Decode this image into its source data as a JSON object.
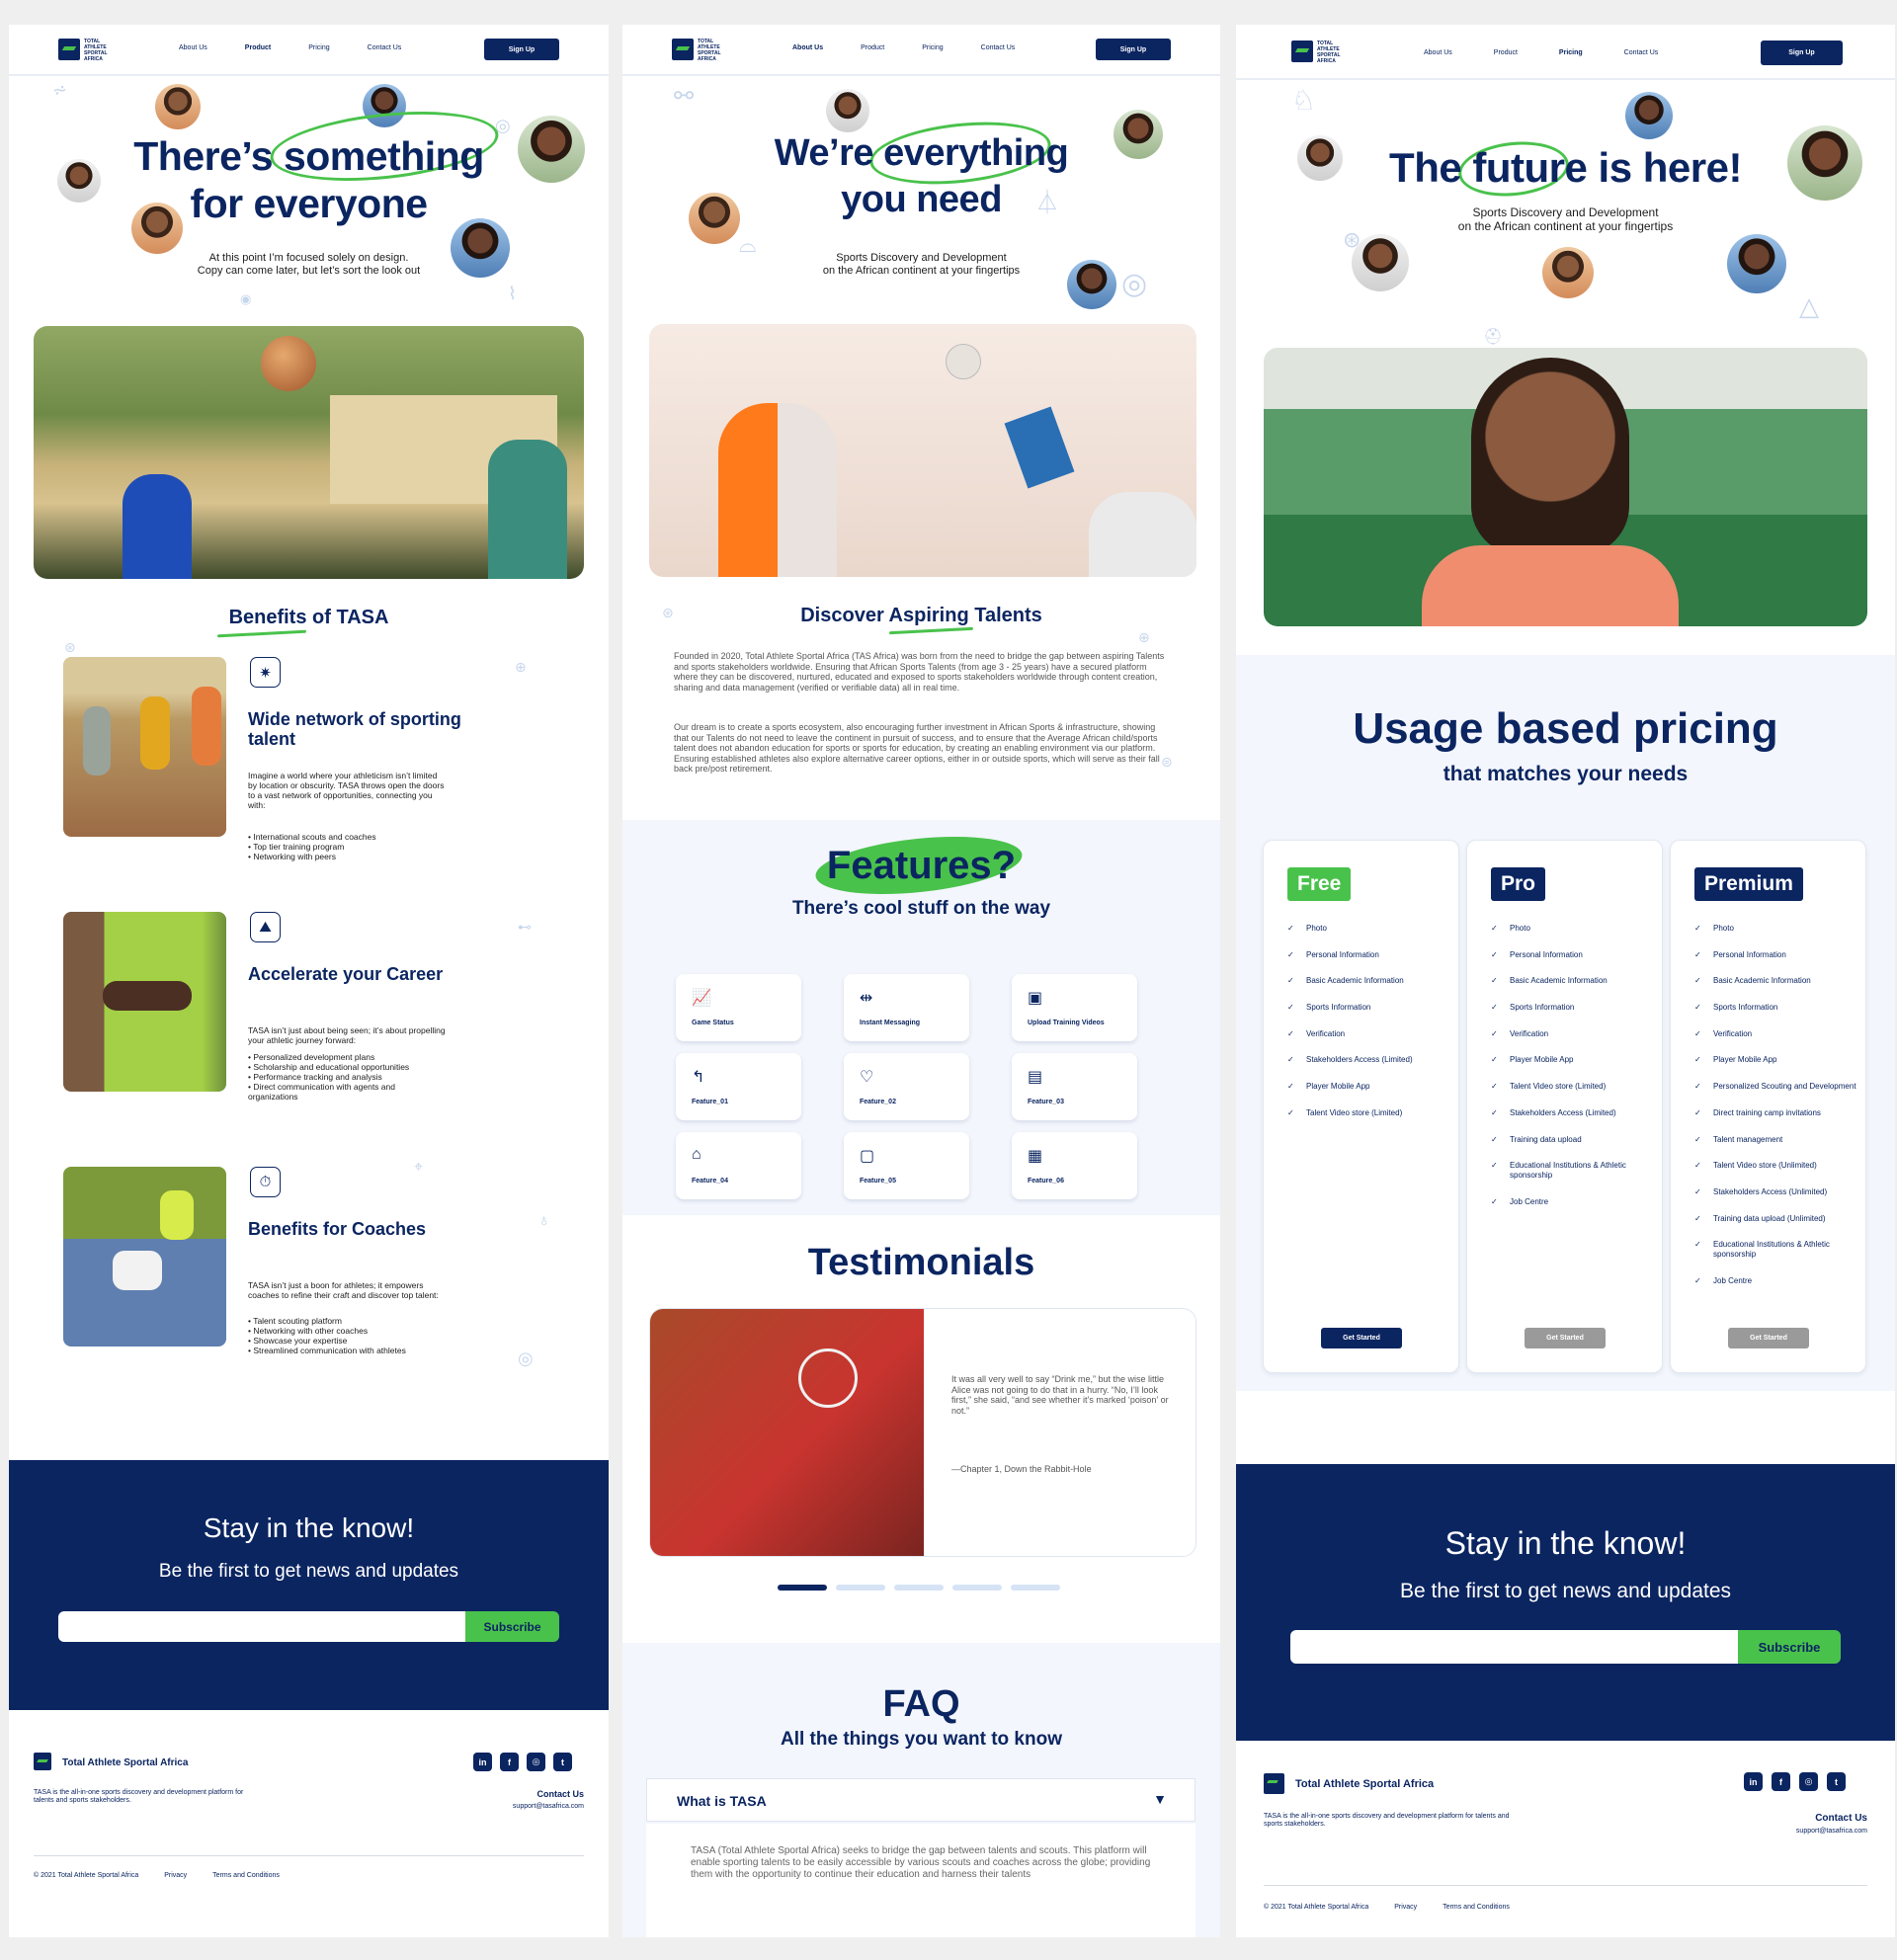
{
  "brand": {
    "logo_text": "TOTAL ATHLETE SPORTAL AFRICA",
    "name": "Total Athlete Sportal Africa",
    "primary": "#0b2561",
    "accent": "#49c24b"
  },
  "nav": {
    "about": "About Us",
    "product": "Product",
    "pricing": "Pricing",
    "contact": "Contact Us",
    "signup": "Sign Up"
  },
  "product_page": {
    "hero_line1": "There’s something",
    "hero_line2": "for everyone",
    "hero_sub1": "At this point I’m focused solely on design.",
    "hero_sub2": "Copy can come later, but let’s sort the look out",
    "benefits_title": "Benefits of TASA",
    "benefits": [
      {
        "title": "Wide network of sporting talent",
        "text": "Imagine a world where your athleticism isn’t limited by location or obscurity. TASA throws open the doors to a vast network of opportunities, connecting you with:",
        "items": [
          "International scouts and coaches",
          "Top tier training program",
          "Networking with peers"
        ]
      },
      {
        "title": "Accelerate your Career",
        "text": "TASA isn’t just about being seen; it’s about propelling your athletic journey forward:",
        "items": [
          "Personalized development plans",
          "Scholarship and educational opportunities",
          "Performance tracking and analysis",
          "Direct communication with agents and organizations"
        ]
      },
      {
        "title": "Benefits for Coaches",
        "text": "TASA isn’t just a boon for athletes; it empowers coaches to refine their craft and discover top talent:",
        "items": [
          "Talent scouting platform",
          "Networking with other coaches",
          "Showcase your expertise",
          "Streamlined communication with athletes"
        ]
      }
    ]
  },
  "about_page": {
    "hero_line1": "We’re everything",
    "hero_line2": "you need",
    "hero_sub1": "Sports Discovery and Development",
    "hero_sub2": "on the African continent at your fingertips",
    "discover_title": "Discover Aspiring Talents",
    "para1": "Founded in 2020, Total Athlete Sportal Africa (TAS Africa) was born from the need to bridge the gap between aspiring Talents and sports stakeholders worldwide. Ensuring that African Sports Talents (from age 3 - 25 years) have a secured platform where they can be discovered, nurtured, educated and exposed to sports stakeholders worldwide through content creation, sharing and data management (verified or verifiable data) all in real time.",
    "para2": "Our dream is to create a sports ecosystem, also encouraging further investment in African Sports & infrastructure, showing that our Talents do not need to leave the continent in pursuit of success, and to ensure that the Average African child/sports talent does not abandon education for sports or sports for education, by creating an enabling environment via our platform. Ensuring established athletes also explore alternative career options, either in or outside sports, which will serve as their fall back pre/post retirement.",
    "features_title": "Features?",
    "features_sub": "There’s cool stuff on the way",
    "features": [
      {
        "label": "Game Status",
        "icon": "chart-board-icon",
        "glyph": "📈"
      },
      {
        "label": "Instant Messaging",
        "icon": "dumbbell-icon",
        "glyph": "⇹"
      },
      {
        "label": "Upload Training Videos",
        "icon": "camera-icon",
        "glyph": "▣"
      },
      {
        "label": "Feature_01",
        "icon": "arm-icon",
        "glyph": "↰"
      },
      {
        "label": "Feature_02",
        "icon": "heart-pulse-icon",
        "glyph": "♡"
      },
      {
        "label": "Feature_03",
        "icon": "clipboard-icon",
        "glyph": "▤"
      },
      {
        "label": "Feature_04",
        "icon": "sneaker-icon",
        "glyph": "⌂"
      },
      {
        "label": "Feature_05",
        "icon": "photo-icon",
        "glyph": "▢"
      },
      {
        "label": "Feature_06",
        "icon": "calendar-icon",
        "glyph": "▦"
      }
    ],
    "testimonials_title": "Testimonials",
    "quote": "It was all very well to say “Drink me,” but the wise little Alice was not going to do that in a hurry. “No, I’ll look first,” she said, “and see whether it’s marked ‘poison’ or not.”",
    "quote_source": "—Chapter 1, Down the Rabbit-Hole",
    "faq_title": "FAQ",
    "faq_sub": "All the things you want to know",
    "faq_q": "What is TASA",
    "faq_a": "TASA (Total Athlete Sportal Africa) seeks to bridge the gap between talents and scouts. This platform will enable sporting talents to be easily accessible by various scouts and coaches across the globe; providing them with the opportunity to continue their education and harness their talents"
  },
  "pricing_page": {
    "hero_line1": "The future is here!",
    "hero_sub1": "Sports Discovery and Development",
    "hero_sub2": "on the African continent at your fingertips",
    "pricing_title": "Usage based pricing",
    "pricing_sub": "that matches your needs",
    "plans": [
      {
        "name": "Free",
        "color": "#49c24b",
        "button": "Get Started",
        "button_color": "#0b2561",
        "items": [
          "Photo",
          "Personal Information",
          "Basic Academic Information",
          "Sports Information",
          "Verification",
          "Stakeholders Access (Limited)",
          "Player Mobile App",
          "Talent Video store (Limited)"
        ]
      },
      {
        "name": "Pro",
        "color": "#0b2561",
        "button": "Get Started",
        "button_color": "#9a9a9a",
        "items": [
          "Photo",
          "Personal Information",
          "Basic Academic Information",
          "Sports Information",
          "Verification",
          "Player Mobile App",
          "Talent Video store (Limited)",
          "Stakeholders Access (Limited)",
          "Training data upload",
          "Educational Institutions & Athletic sponsorship",
          "Job Centre"
        ]
      },
      {
        "name": "Premium",
        "color": "#0b2561",
        "button": "Get Started",
        "button_color": "#9a9a9a",
        "items": [
          "Photo",
          "Personal Information",
          "Basic Academic Information",
          "Sports Information",
          "Verification",
          "Player Mobile App",
          "Personalized Scouting and Development",
          "Direct training camp invitations",
          "Talent management",
          "Talent Video store (Unlimited)",
          "Stakeholders Access (Unlimited)",
          "Training data upload (Unlimited)",
          "Educational Institutions & Athletic sponsorship",
          "Job Centre"
        ]
      }
    ]
  },
  "newsletter": {
    "title": "Stay in the know!",
    "sub": "Be the first to get news and updates",
    "button": "Subscribe",
    "placeholder": ""
  },
  "footer": {
    "desc": "TASA is the all-in-one sports discovery and development platform for talents and sports stakeholders.",
    "contact_label": "Contact Us",
    "email": "support@tasafrica.com",
    "copyright": "© 2021 Total Athlete Sportal Africa",
    "privacy": "Privacy",
    "terms": "Terms and Conditions",
    "socials": [
      "in",
      "f",
      "◎",
      "t"
    ]
  }
}
